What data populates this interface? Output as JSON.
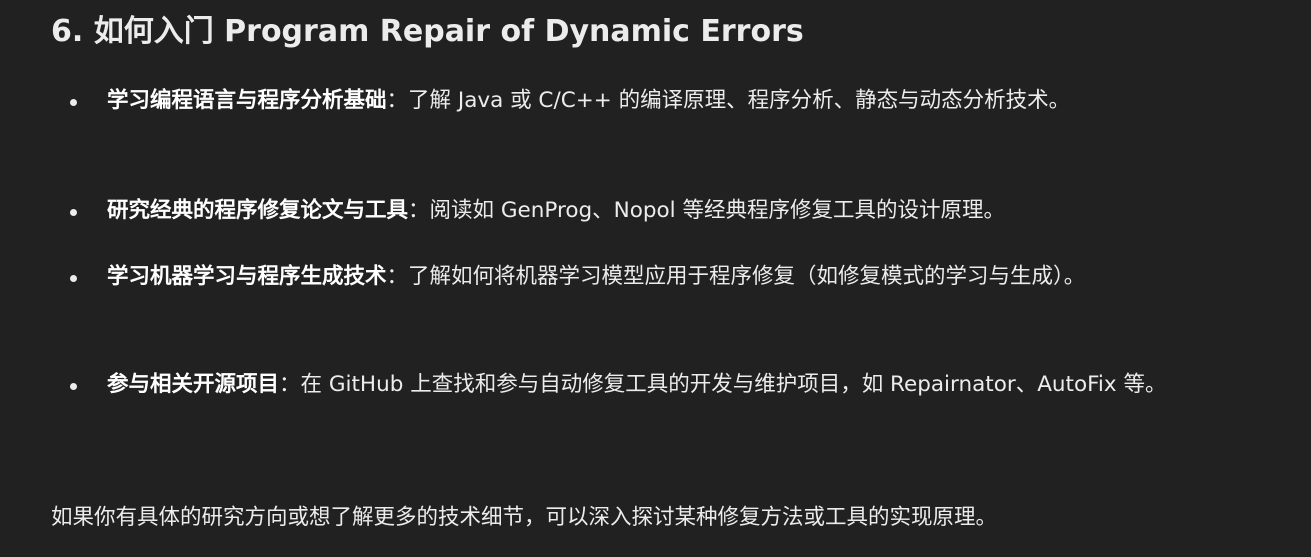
{
  "section": {
    "heading": "6. 如何入门 Program Repair of Dynamic Errors"
  },
  "bullets": [
    {
      "title": "学习编程语言与程序分析基础",
      "text": "：了解 Java 或 C/C++ 的编译原理、程序分析、静态与动态分析技术。"
    },
    {
      "title": "研究经典的程序修复论文与工具",
      "text": "：阅读如 GenProg、Nopol 等经典程序修复工具的设计原理。"
    },
    {
      "title": "学习机器学习与程序生成技术",
      "text": "：了解如何将机器学习模型应用于程序修复（如修复模式的学习与生成）。"
    },
    {
      "title": "参与相关开源项目",
      "text": "：在 GitHub 上查找和参与自动修复工具的开发与维护项目，如 Repairnator、AutoFix 等。"
    }
  ],
  "conclusion": "如果你有具体的研究方向或想了解更多的技术细节，可以深入探讨某种修复方法或工具的实现原理。"
}
